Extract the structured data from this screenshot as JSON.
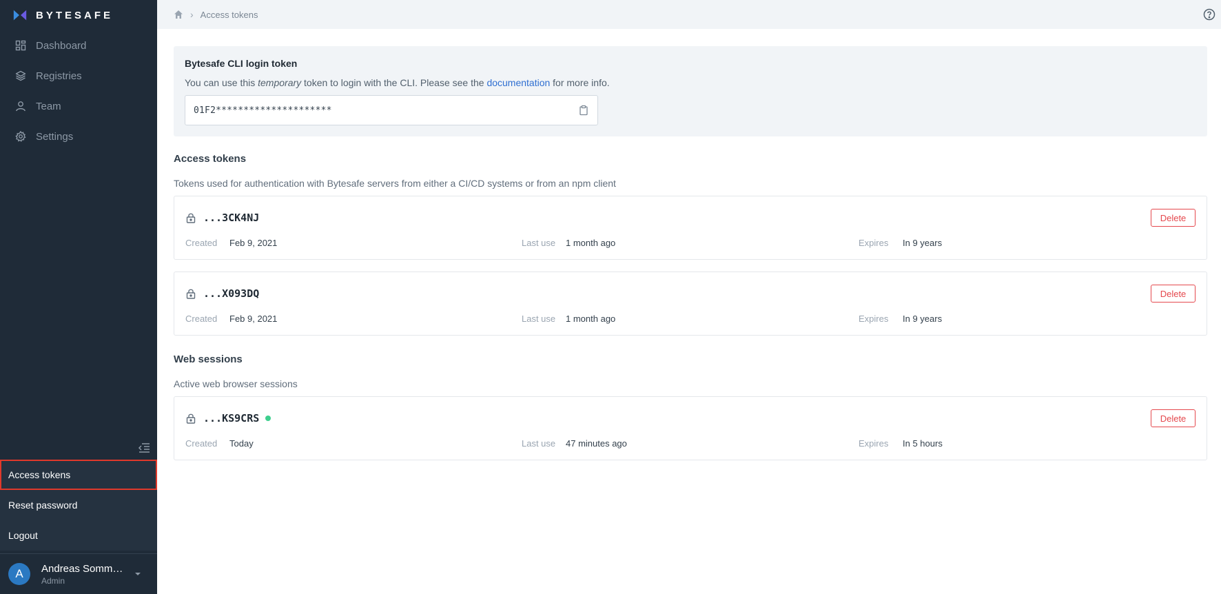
{
  "app": {
    "brand": "BYTESAFE"
  },
  "sidebar": {
    "nav": [
      {
        "label": "Dashboard",
        "icon": "dashboard-icon"
      },
      {
        "label": "Registries",
        "icon": "layers-icon"
      },
      {
        "label": "Team",
        "icon": "user-icon"
      },
      {
        "label": "Settings",
        "icon": "gear-icon"
      }
    ],
    "menu": [
      {
        "label": "Access tokens",
        "active": true
      },
      {
        "label": "Reset password"
      },
      {
        "label": "Logout"
      }
    ],
    "user": {
      "initial": "A",
      "name": "Andreas Sommar...",
      "role": "Admin"
    }
  },
  "header": {
    "breadcrumb": [
      "Access tokens"
    ]
  },
  "cli": {
    "title": "Bytesafe CLI login token",
    "desc_before": "You can use this ",
    "desc_em": "temporary",
    "desc_middle": " token to login with the CLI. Please see the ",
    "desc_link": "documentation",
    "desc_after": " for more info.",
    "token": "01F2*********************"
  },
  "access_tokens": {
    "title": "Access tokens",
    "desc": "Tokens used for authentication with Bytesafe servers from either a CI/CD systems or from an npm client",
    "items": [
      {
        "id": "...3CK4NJ",
        "created_label": "Created",
        "created": "Feb 9, 2021",
        "last_use_label": "Last use",
        "last_use": "1 month ago",
        "expires_label": "Expires",
        "expires": "In 9 years",
        "delete_label": "Delete"
      },
      {
        "id": "...X093DQ",
        "created_label": "Created",
        "created": "Feb 9, 2021",
        "last_use_label": "Last use",
        "last_use": "1 month ago",
        "expires_label": "Expires",
        "expires": "In 9 years",
        "delete_label": "Delete"
      }
    ]
  },
  "web_sessions": {
    "title": "Web sessions",
    "desc": "Active web browser sessions",
    "items": [
      {
        "id": "...KS9CRS",
        "created_label": "Created",
        "created": "Today",
        "last_use_label": "Last use",
        "last_use": "47 minutes ago",
        "expires_label": "Expires",
        "expires": "In 5 hours",
        "delete_label": "Delete"
      }
    ]
  },
  "colors": {
    "sidebar": "#1f2b38",
    "accent_link": "#2f6fd1",
    "danger": "#e5484d",
    "active_dot": "#3ecf8e"
  }
}
